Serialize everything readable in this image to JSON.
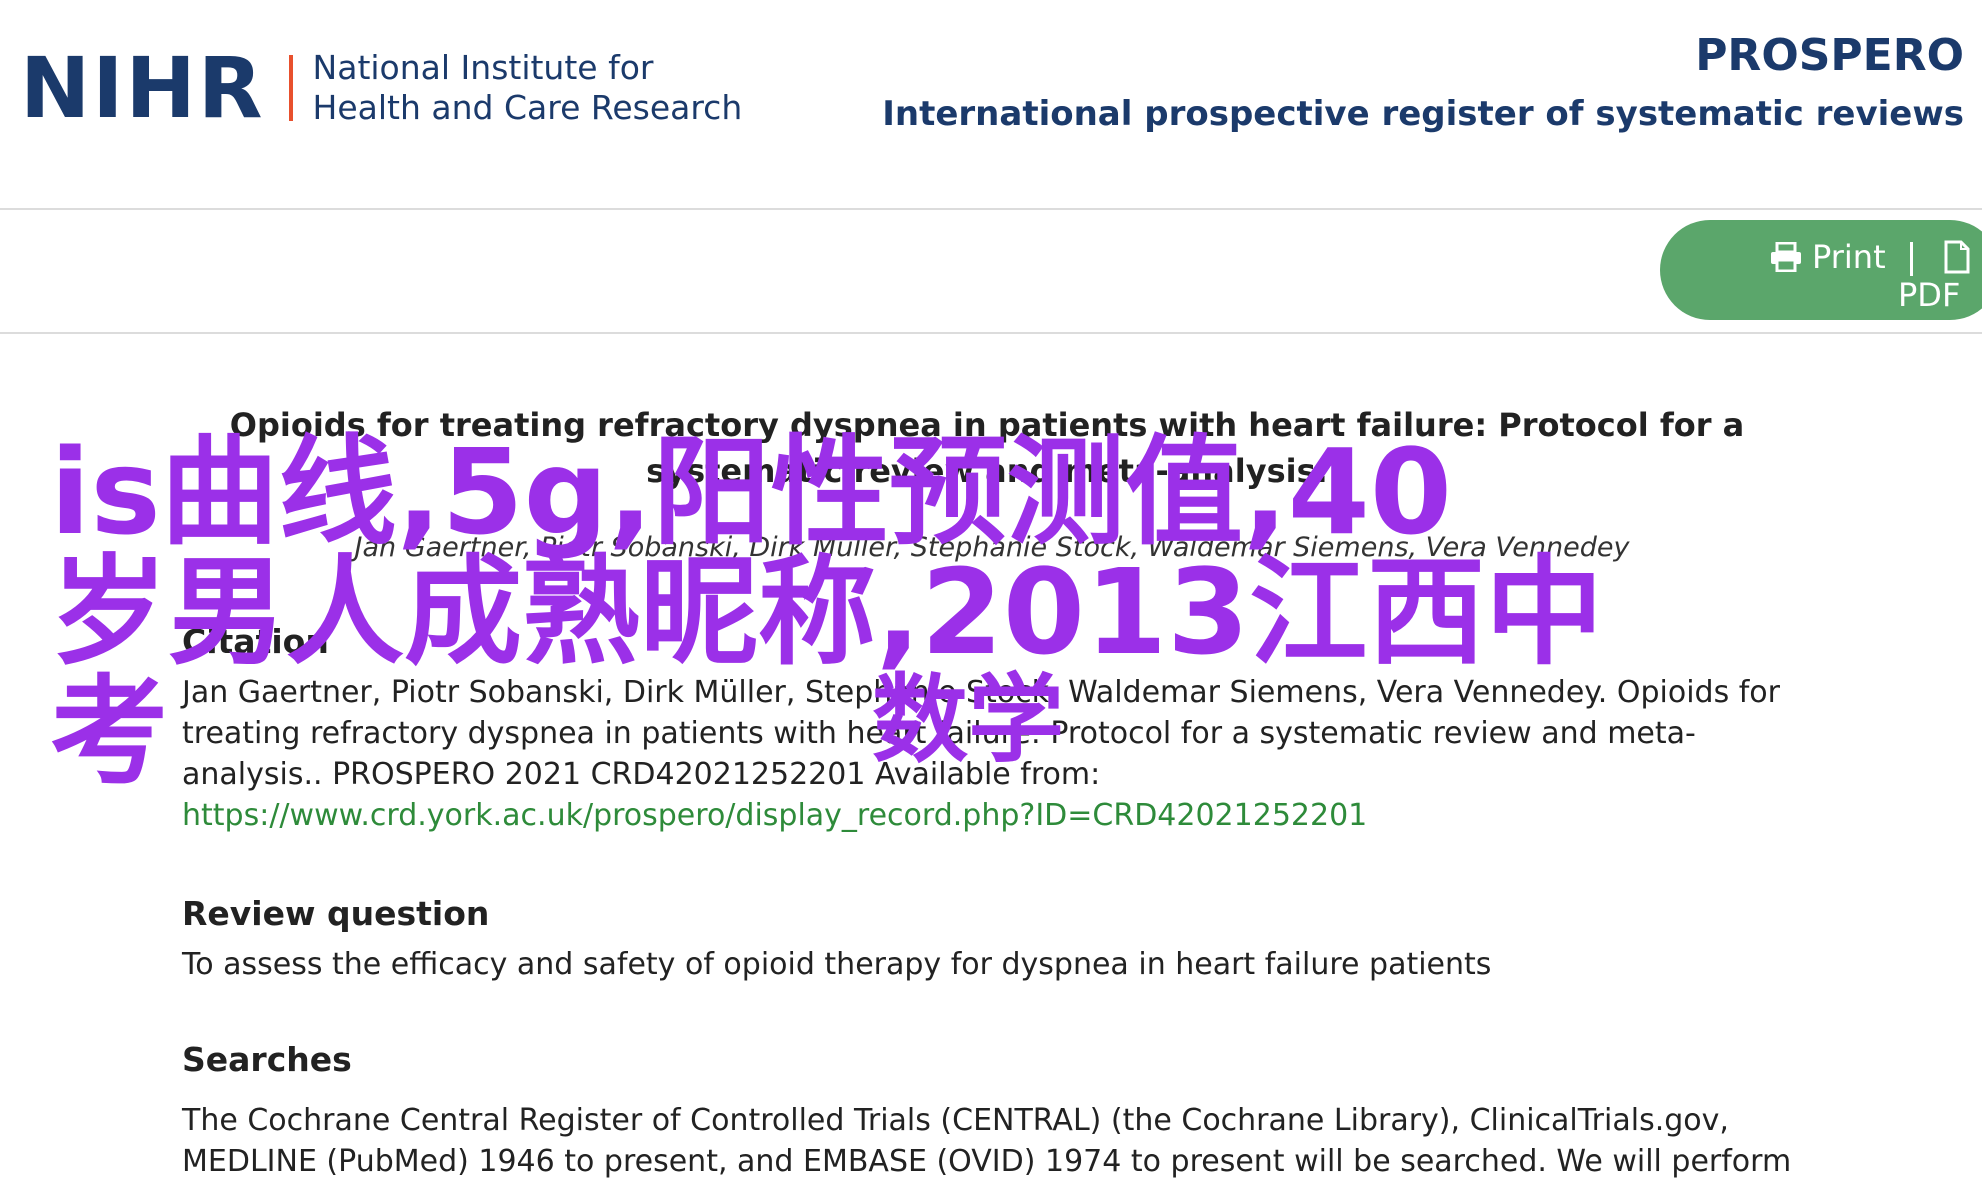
{
  "header": {
    "logo_mark": "NIHR",
    "logo_text_line1": "National Institute for",
    "logo_text_line2": "Health and Care Research",
    "site_title": "PROSPERO",
    "site_subtitle": "International prospective register of systematic reviews",
    "brand_color": "#1b3a6b",
    "accent_color": "#e8502d"
  },
  "toolbar": {
    "print_label": "Print",
    "pdf_label": "PDF",
    "pill_color": "#5ba66b"
  },
  "record": {
    "title": "Opioids for treating refractory dyspnea in patients with heart failure: Protocol for a systematic review and meta-analysis.",
    "authors": "Jan Gaertner, Piotr Sobanski, Dirk Müller, Stephanie Stock, Waldemar Siemens, Vera Vennedey",
    "citation_heading": "Citation",
    "citation_text": "Jan Gaertner, Piotr Sobanski, Dirk Müller, Stephanie Stock, Waldemar Siemens, Vera Vennedey. Opioids for treating refractory dyspnea in patients with heart failure: Protocol for a systematic review and meta-analysis.. PROSPERO 2021 CRD42021252201 Available from:",
    "citation_url": "https://www.crd.york.ac.uk/prospero/display_record.php?ID=CRD42021252201",
    "review_question_heading": "Review question",
    "review_question_text": "To assess the efficacy and safety of opioid therapy for dyspnea in heart failure patients",
    "searches_heading": "Searches",
    "searches_text": "The Cochrane Central Register of Controlled Trials (CENTRAL) (the Cochrane Library), ClinicalTrials.gov, MEDLINE (PubMed) 1946 to present, and EMBASE (OVID) 1974 to present will be searched. We will perform"
  },
  "overlay": {
    "line1": "is曲线,5g,阳性预测值,40",
    "line2": "岁男人成熟昵称,2013江西中考",
    "line3": "数学",
    "color": "#9b30e8"
  }
}
